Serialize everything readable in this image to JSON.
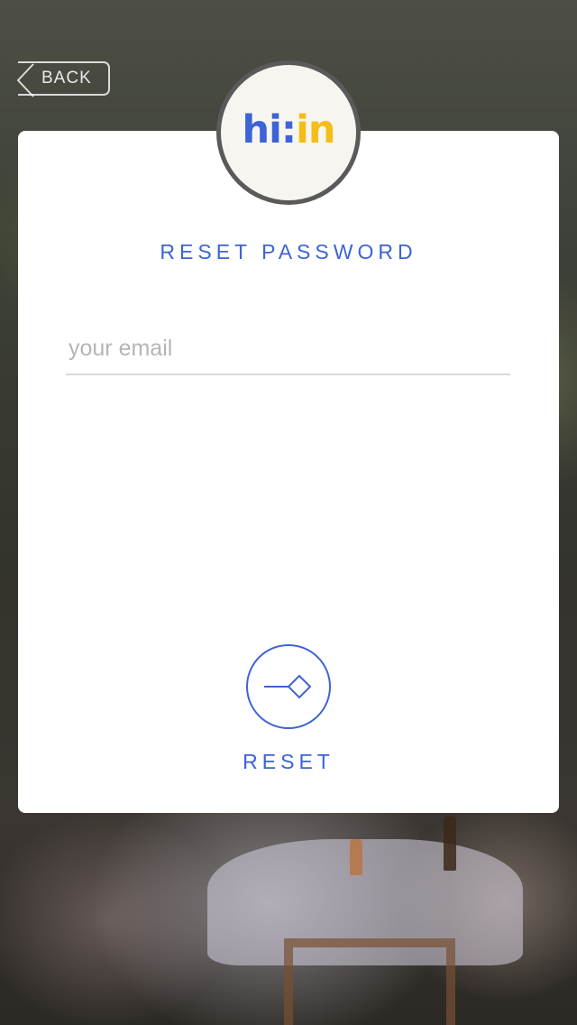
{
  "header": {
    "back_label": "BACK"
  },
  "logo": {
    "part1": "hi",
    "separator": ":",
    "part2": "in"
  },
  "form": {
    "title": "RESET PASSWORD",
    "email_placeholder": "your email",
    "email_value": ""
  },
  "actions": {
    "reset_label": "RESET",
    "reset_icon": "arrow-diamond-icon"
  },
  "colors": {
    "accent": "#3d63d6",
    "logo_yellow": "#f5bd18",
    "card_bg": "#ffffff"
  }
}
